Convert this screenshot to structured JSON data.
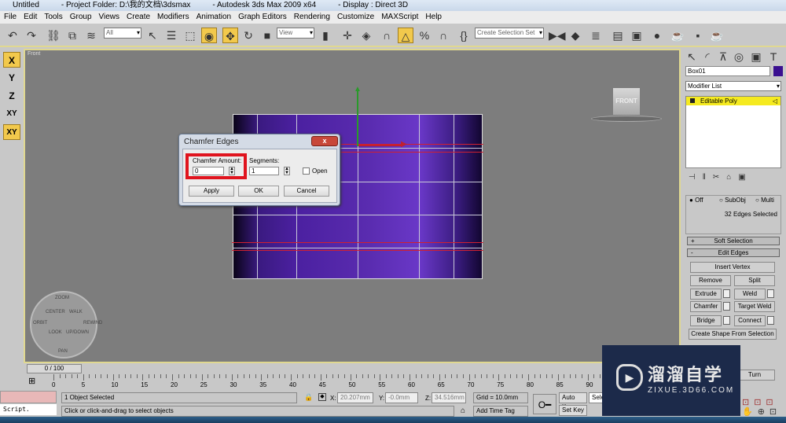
{
  "title": {
    "file": "Untitled",
    "project": "- Project Folder: D:\\我的文档\\3dsmax",
    "app": "- Autodesk 3ds Max  2009 x64",
    "display": "- Display : Direct 3D"
  },
  "menu": [
    "File",
    "Edit",
    "Tools",
    "Group",
    "Views",
    "Create",
    "Modifiers",
    "Animation",
    "Graph Editors",
    "Rendering",
    "Customize",
    "MAXScript",
    "Help"
  ],
  "toolbar": {
    "filter": "All",
    "coord": "View",
    "selection_set": "Create Selection Set"
  },
  "axis_constraints": [
    "X",
    "Y",
    "Z",
    "XY",
    "XY"
  ],
  "viewport": {
    "label": "Front",
    "viewcube": "FRONT",
    "wheel": [
      "ZOOM",
      "ORBIT",
      "CENTER",
      "WALK",
      "REWIND",
      "LOOK",
      "UP/DOWN",
      "PAN"
    ]
  },
  "dialog": {
    "title": "Chamfer Edges",
    "close": "x",
    "amount_label": "Chamfer Amount:",
    "amount_value": "0",
    "segments_label": "Segments:",
    "segments_value": "1",
    "open_label": "Open",
    "open_checked": false,
    "apply": "Apply",
    "ok": "OK",
    "cancel": "Cancel",
    "highlight_color": "#e0141e"
  },
  "panel": {
    "object_name": "Box01",
    "object_color": "#3a1090",
    "modifier_list": "Modifier List",
    "stack": [
      "Editable Poly"
    ],
    "preview": [
      "Off",
      "SubObj",
      "Multi"
    ],
    "selected_info": "32 Edges Selected",
    "soft_selection": "Soft Selection",
    "soft_sign": "+",
    "edit_edges": "Edit Edges",
    "edit_sign": "-",
    "buttons": {
      "insert_vertex": "Insert Vertex",
      "remove": "Remove",
      "split": "Split",
      "extrude": "Extrude",
      "weld": "Weld",
      "chamfer": "Chamfer",
      "target_weld": "Target Weld",
      "bridge": "Bridge",
      "connect": "Connect",
      "create_shape": "Create Shape From Selection",
      "turn": "Turn"
    }
  },
  "timeline": {
    "frame": "0 / 100",
    "ticks": [
      "0",
      "5",
      "10",
      "15",
      "20",
      "25",
      "30",
      "35",
      "40",
      "45",
      "50",
      "55",
      "60",
      "65",
      "70",
      "75",
      "80",
      "85",
      "90"
    ]
  },
  "status": {
    "selected": "1 Object Selected",
    "prompt": "Click or click-and-drag to select objects",
    "x": "20.207mm",
    "y": "-0.0mm",
    "z": "34.516mm",
    "x_label": "X:",
    "y_label": "Y:",
    "z_label": "Z:",
    "grid": "Grid = 10.0mm",
    "add_time_tag": "Add Time Tag",
    "auto_key": "Auto Key",
    "set_key": "Set Key",
    "selected_combo": "Sele",
    "script": "Script."
  },
  "watermark": {
    "title": "溜溜自学",
    "sub": "ZIXUE.3D66.COM"
  }
}
